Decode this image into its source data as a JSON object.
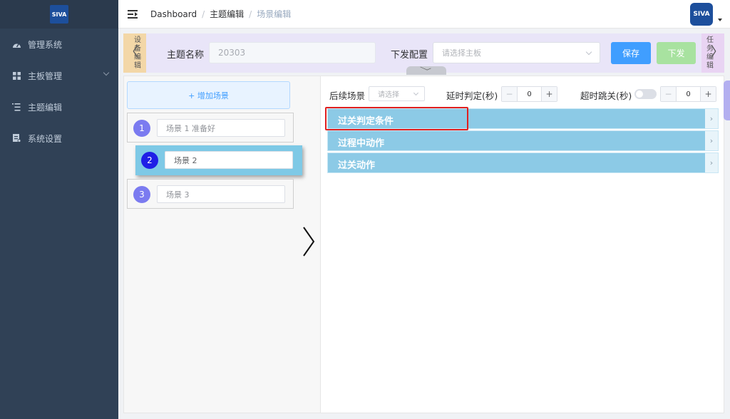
{
  "sidebar": {
    "logo_text": "SIVA",
    "items": [
      {
        "label": "管理系统",
        "icon": "dashboard-icon"
      },
      {
        "label": "主板管理",
        "icon": "grid-icon",
        "has_chevron": true
      },
      {
        "label": "主题编辑",
        "icon": "list-icon"
      },
      {
        "label": "系统设置",
        "icon": "document-icon"
      }
    ]
  },
  "navbar": {
    "breadcrumb": [
      "Dashboard",
      "主题编辑",
      "场景编辑"
    ],
    "avatar_text": "SIVA"
  },
  "config": {
    "left_tab": [
      "设",
      "备",
      "编",
      "辑"
    ],
    "right_tab": [
      "任",
      "务",
      "编",
      "辑"
    ],
    "theme_name_label": "主题名称",
    "theme_name_value": "20303",
    "dispatch_label": "下发配置",
    "dispatch_placeholder": "请选择主板",
    "save_label": "保存",
    "dispatch_button_label": "下发"
  },
  "scenes": {
    "add_label": "+ 增加场景",
    "items": [
      {
        "num": "1",
        "name": "场景 1 准备好"
      },
      {
        "num": "2",
        "name": "场景 2"
      },
      {
        "num": "3",
        "name": "场景 3"
      }
    ],
    "active_index": 1
  },
  "scene_settings": {
    "next_scene_label": "后续场景",
    "next_scene_placeholder": "请选择",
    "delay_label": "延时判定(秒)",
    "delay_value": "0",
    "timeout_label": "超时跳关(秒)",
    "timeout_value": "0",
    "timeout_enabled": false,
    "minus": "−",
    "plus": "+"
  },
  "sections": [
    {
      "title": "过关判定条件",
      "arrow": "›"
    },
    {
      "title": "过程中动作",
      "arrow": "›"
    },
    {
      "title": "过关动作",
      "arrow": "›"
    }
  ],
  "colors": {
    "sidebar_bg": "#304156",
    "primary": "#409eff",
    "success_disabled": "#a8e2a0",
    "section_bg": "#8ccae6",
    "highlight": "#e02020"
  }
}
